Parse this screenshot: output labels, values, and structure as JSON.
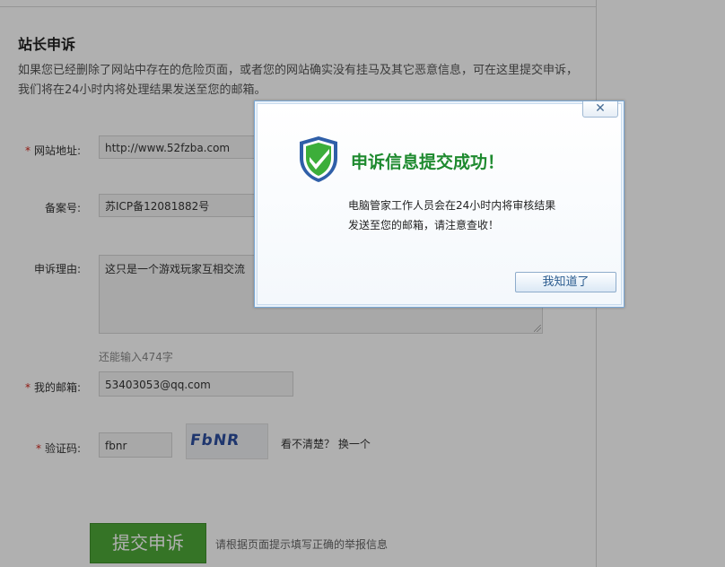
{
  "page": {
    "title": "站长申诉",
    "intro": "如果您已经删除了网站中存在的危险页面，或者您的网站确实没有挂马及其它恶意信息，可在这里提交申诉，我们将在24小时内将处理结果发送至您的邮箱。"
  },
  "form": {
    "required_mark": "*",
    "site": {
      "label": "网站地址:",
      "value": "http://www.52fzba.com"
    },
    "icp": {
      "label": "备案号:",
      "value": "苏ICP备12081882号"
    },
    "reason": {
      "label": "申诉理由:",
      "value": "这只是一个游戏玩家互相交流",
      "remaining": "还能输入474字"
    },
    "email": {
      "label": "我的邮箱:",
      "value": "53403053@qq.com"
    },
    "captcha": {
      "label": "验证码:",
      "value": "fbnr",
      "image_text": "FbNR",
      "unclear": "看不清楚？",
      "refresh": "换一个"
    },
    "submit_label": "提交申诉",
    "submit_hint": "请根据页面提示填写正确的举报信息"
  },
  "dialog": {
    "close_glyph": "✕",
    "title": "申诉信息提交成功！",
    "message_line1": "电脑管家工作人员会在24小时内将审核结果",
    "message_line2": "发送至您的邮箱，请注意查收！",
    "ok_label": "我知道了"
  },
  "colors": {
    "accent_green": "#4da837",
    "dialog_title_green": "#1e8a2f",
    "shield_blue": "#2f5fa8",
    "required_red": "#d0261b"
  }
}
